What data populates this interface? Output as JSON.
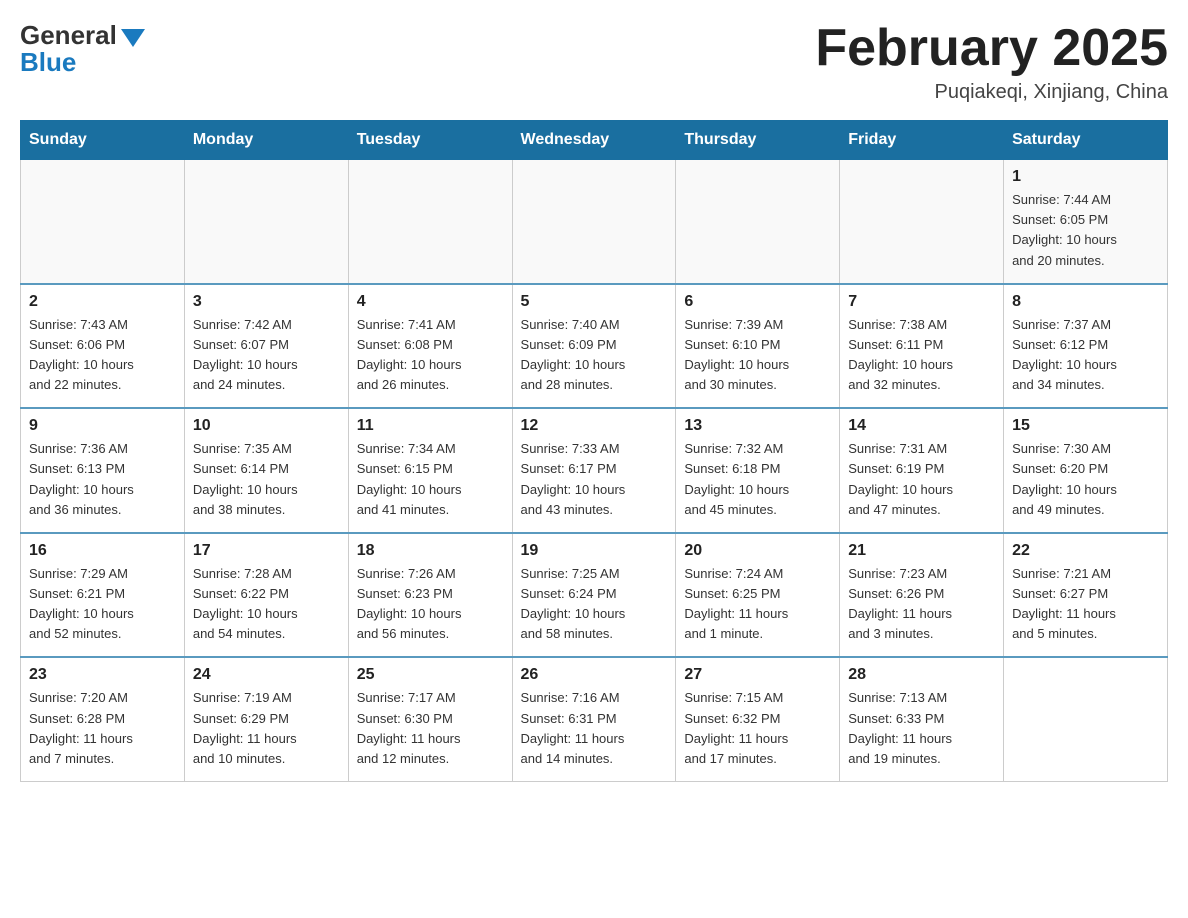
{
  "header": {
    "logo_general": "General",
    "logo_arrow": "▶",
    "logo_blue": "Blue",
    "month_title": "February 2025",
    "location": "Puqiakeqi, Xinjiang, China"
  },
  "weekdays": [
    "Sunday",
    "Monday",
    "Tuesday",
    "Wednesday",
    "Thursday",
    "Friday",
    "Saturday"
  ],
  "weeks": [
    {
      "days": [
        {
          "number": "",
          "info": ""
        },
        {
          "number": "",
          "info": ""
        },
        {
          "number": "",
          "info": ""
        },
        {
          "number": "",
          "info": ""
        },
        {
          "number": "",
          "info": ""
        },
        {
          "number": "",
          "info": ""
        },
        {
          "number": "1",
          "info": "Sunrise: 7:44 AM\nSunset: 6:05 PM\nDaylight: 10 hours\nand 20 minutes."
        }
      ]
    },
    {
      "days": [
        {
          "number": "2",
          "info": "Sunrise: 7:43 AM\nSunset: 6:06 PM\nDaylight: 10 hours\nand 22 minutes."
        },
        {
          "number": "3",
          "info": "Sunrise: 7:42 AM\nSunset: 6:07 PM\nDaylight: 10 hours\nand 24 minutes."
        },
        {
          "number": "4",
          "info": "Sunrise: 7:41 AM\nSunset: 6:08 PM\nDaylight: 10 hours\nand 26 minutes."
        },
        {
          "number": "5",
          "info": "Sunrise: 7:40 AM\nSunset: 6:09 PM\nDaylight: 10 hours\nand 28 minutes."
        },
        {
          "number": "6",
          "info": "Sunrise: 7:39 AM\nSunset: 6:10 PM\nDaylight: 10 hours\nand 30 minutes."
        },
        {
          "number": "7",
          "info": "Sunrise: 7:38 AM\nSunset: 6:11 PM\nDaylight: 10 hours\nand 32 minutes."
        },
        {
          "number": "8",
          "info": "Sunrise: 7:37 AM\nSunset: 6:12 PM\nDaylight: 10 hours\nand 34 minutes."
        }
      ]
    },
    {
      "days": [
        {
          "number": "9",
          "info": "Sunrise: 7:36 AM\nSunset: 6:13 PM\nDaylight: 10 hours\nand 36 minutes."
        },
        {
          "number": "10",
          "info": "Sunrise: 7:35 AM\nSunset: 6:14 PM\nDaylight: 10 hours\nand 38 minutes."
        },
        {
          "number": "11",
          "info": "Sunrise: 7:34 AM\nSunset: 6:15 PM\nDaylight: 10 hours\nand 41 minutes."
        },
        {
          "number": "12",
          "info": "Sunrise: 7:33 AM\nSunset: 6:17 PM\nDaylight: 10 hours\nand 43 minutes."
        },
        {
          "number": "13",
          "info": "Sunrise: 7:32 AM\nSunset: 6:18 PM\nDaylight: 10 hours\nand 45 minutes."
        },
        {
          "number": "14",
          "info": "Sunrise: 7:31 AM\nSunset: 6:19 PM\nDaylight: 10 hours\nand 47 minutes."
        },
        {
          "number": "15",
          "info": "Sunrise: 7:30 AM\nSunset: 6:20 PM\nDaylight: 10 hours\nand 49 minutes."
        }
      ]
    },
    {
      "days": [
        {
          "number": "16",
          "info": "Sunrise: 7:29 AM\nSunset: 6:21 PM\nDaylight: 10 hours\nand 52 minutes."
        },
        {
          "number": "17",
          "info": "Sunrise: 7:28 AM\nSunset: 6:22 PM\nDaylight: 10 hours\nand 54 minutes."
        },
        {
          "number": "18",
          "info": "Sunrise: 7:26 AM\nSunset: 6:23 PM\nDaylight: 10 hours\nand 56 minutes."
        },
        {
          "number": "19",
          "info": "Sunrise: 7:25 AM\nSunset: 6:24 PM\nDaylight: 10 hours\nand 58 minutes."
        },
        {
          "number": "20",
          "info": "Sunrise: 7:24 AM\nSunset: 6:25 PM\nDaylight: 11 hours\nand 1 minute."
        },
        {
          "number": "21",
          "info": "Sunrise: 7:23 AM\nSunset: 6:26 PM\nDaylight: 11 hours\nand 3 minutes."
        },
        {
          "number": "22",
          "info": "Sunrise: 7:21 AM\nSunset: 6:27 PM\nDaylight: 11 hours\nand 5 minutes."
        }
      ]
    },
    {
      "days": [
        {
          "number": "23",
          "info": "Sunrise: 7:20 AM\nSunset: 6:28 PM\nDaylight: 11 hours\nand 7 minutes."
        },
        {
          "number": "24",
          "info": "Sunrise: 7:19 AM\nSunset: 6:29 PM\nDaylight: 11 hours\nand 10 minutes."
        },
        {
          "number": "25",
          "info": "Sunrise: 7:17 AM\nSunset: 6:30 PM\nDaylight: 11 hours\nand 12 minutes."
        },
        {
          "number": "26",
          "info": "Sunrise: 7:16 AM\nSunset: 6:31 PM\nDaylight: 11 hours\nand 14 minutes."
        },
        {
          "number": "27",
          "info": "Sunrise: 7:15 AM\nSunset: 6:32 PM\nDaylight: 11 hours\nand 17 minutes."
        },
        {
          "number": "28",
          "info": "Sunrise: 7:13 AM\nSunset: 6:33 PM\nDaylight: 11 hours\nand 19 minutes."
        },
        {
          "number": "",
          "info": ""
        }
      ]
    }
  ]
}
